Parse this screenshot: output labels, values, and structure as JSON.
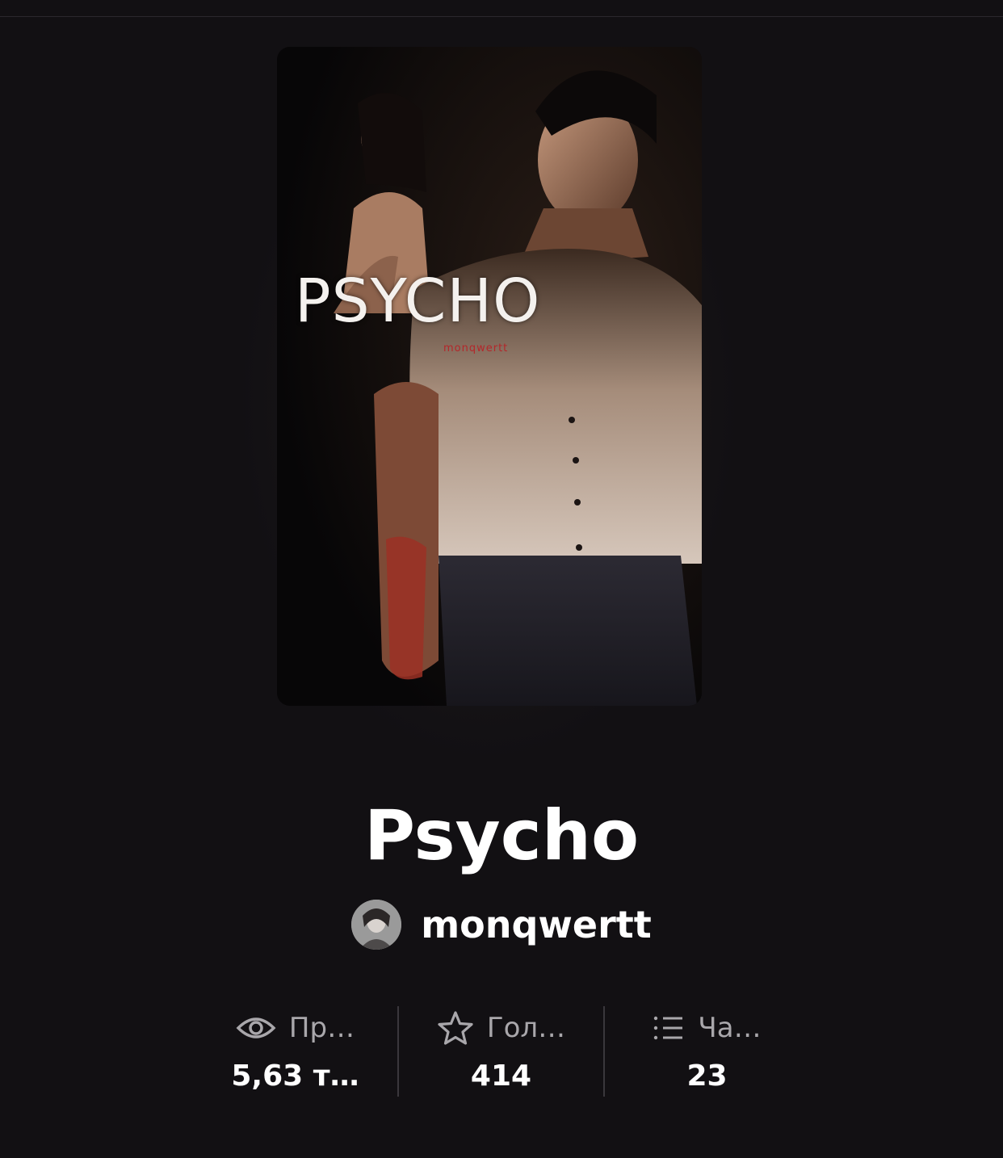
{
  "story": {
    "cover_title": "PSYCHO",
    "cover_author": "monqwertt",
    "title": "Psycho",
    "author": "monqwertt"
  },
  "stats": [
    {
      "icon": "eye-icon",
      "label": "Пр…",
      "value": "5,63 т…"
    },
    {
      "icon": "star-icon",
      "label": "Гол…",
      "value": "414"
    },
    {
      "icon": "list-icon",
      "label": "Ча…",
      "value": "23"
    }
  ],
  "colors": {
    "background": "#121013",
    "text": "#ffffff",
    "muted": "#a9a7ab",
    "separator": "#3a373c",
    "cover_author_red": "#b4262a"
  }
}
